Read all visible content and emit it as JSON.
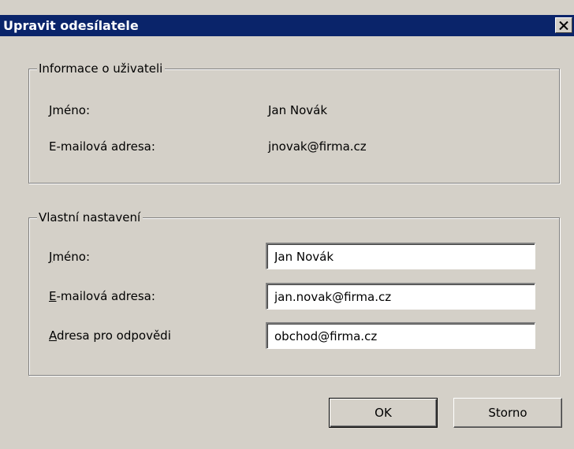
{
  "dialog": {
    "title": "Upravit odesílatele",
    "close_icon": "close-icon"
  },
  "user_info": {
    "legend": "Informace o uživateli",
    "name_label": "Jméno:",
    "name_value": "Jan Novák",
    "email_label": "E-mailová adresa:",
    "email_value": "jnovak@firma.cz"
  },
  "custom_settings": {
    "legend": "Vlastní nastavení",
    "name_label_mnemonic": "J",
    "name_label_rest": "méno:",
    "name_value": "Jan Novák",
    "email_label_mnemonic": "E",
    "email_label_rest": "-mailová adresa:",
    "email_value": "jan.novak@firma.cz",
    "reply_label_mnemonic": "A",
    "reply_label_rest": "dresa pro odpovědi",
    "reply_value": "obchod@firma.cz"
  },
  "buttons": {
    "ok_label": "OK",
    "cancel_label": "Storno"
  },
  "colors": {
    "titlebar": "#0a246a",
    "dialog_bg": "#d4d0c8"
  }
}
